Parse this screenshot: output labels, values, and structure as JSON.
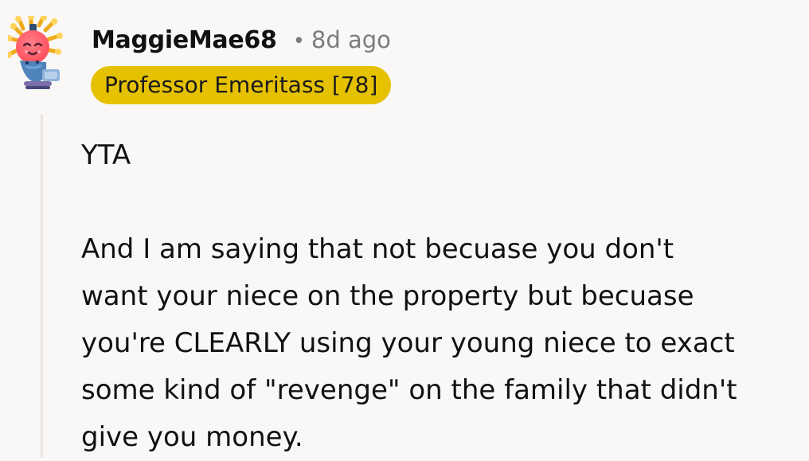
{
  "comment": {
    "author": "MaggieMae68",
    "separator": "•",
    "age": "8d ago",
    "flair": "Professor Emeritass [78]",
    "avatar_icon": "rainbow-octopus-avatar-icon",
    "paragraphs": [
      "YTA",
      "And I am saying that not becuase you don't\nwant your niece on the property but becuase\nyou're CLEARLY using your young niece to exact\nsome kind of \"revenge\" on the family that didn't\ngive you money."
    ]
  },
  "colors": {
    "background": "#f9f8f7",
    "flair_background": "#e5c100",
    "metadata": "#7c7c7c",
    "thread_line": "#e8e5e3"
  }
}
